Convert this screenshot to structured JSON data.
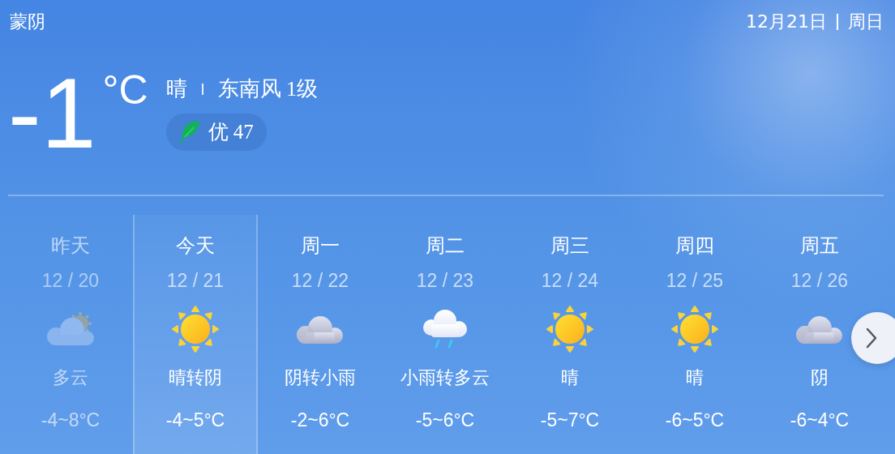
{
  "header": {
    "location": "蒙阴",
    "date": "12月21日",
    "weekday": "周日"
  },
  "current": {
    "temperature": "-1",
    "unit": "°C",
    "condition": "晴",
    "wind": "东南风 1级",
    "air_quality": "优 47"
  },
  "forecast": [
    {
      "day": "昨天",
      "date": "12 / 20",
      "kind": "partly_cloudy",
      "condition": "多云",
      "temp": "-4~8°C",
      "past": true,
      "selected": false
    },
    {
      "day": "今天",
      "date": "12 / 21",
      "kind": "sunny",
      "condition": "晴转阴",
      "temp": "-4~5°C",
      "past": false,
      "selected": true
    },
    {
      "day": "周一",
      "date": "12 / 22",
      "kind": "cloudy",
      "condition": "阴转小雨",
      "temp": "-2~6°C",
      "past": false,
      "selected": false
    },
    {
      "day": "周二",
      "date": "12 / 23",
      "kind": "rain",
      "condition": "小雨转多云",
      "temp": "-5~6°C",
      "past": false,
      "selected": false
    },
    {
      "day": "周三",
      "date": "12 / 24",
      "kind": "sunny",
      "condition": "晴",
      "temp": "-5~7°C",
      "past": false,
      "selected": false
    },
    {
      "day": "周四",
      "date": "12 / 25",
      "kind": "sunny",
      "condition": "晴",
      "temp": "-6~5°C",
      "past": false,
      "selected": false
    },
    {
      "day": "周五",
      "date": "12 / 26",
      "kind": "cloudy",
      "condition": "阴",
      "temp": "-6~4°C",
      "past": false,
      "selected": false
    }
  ]
}
